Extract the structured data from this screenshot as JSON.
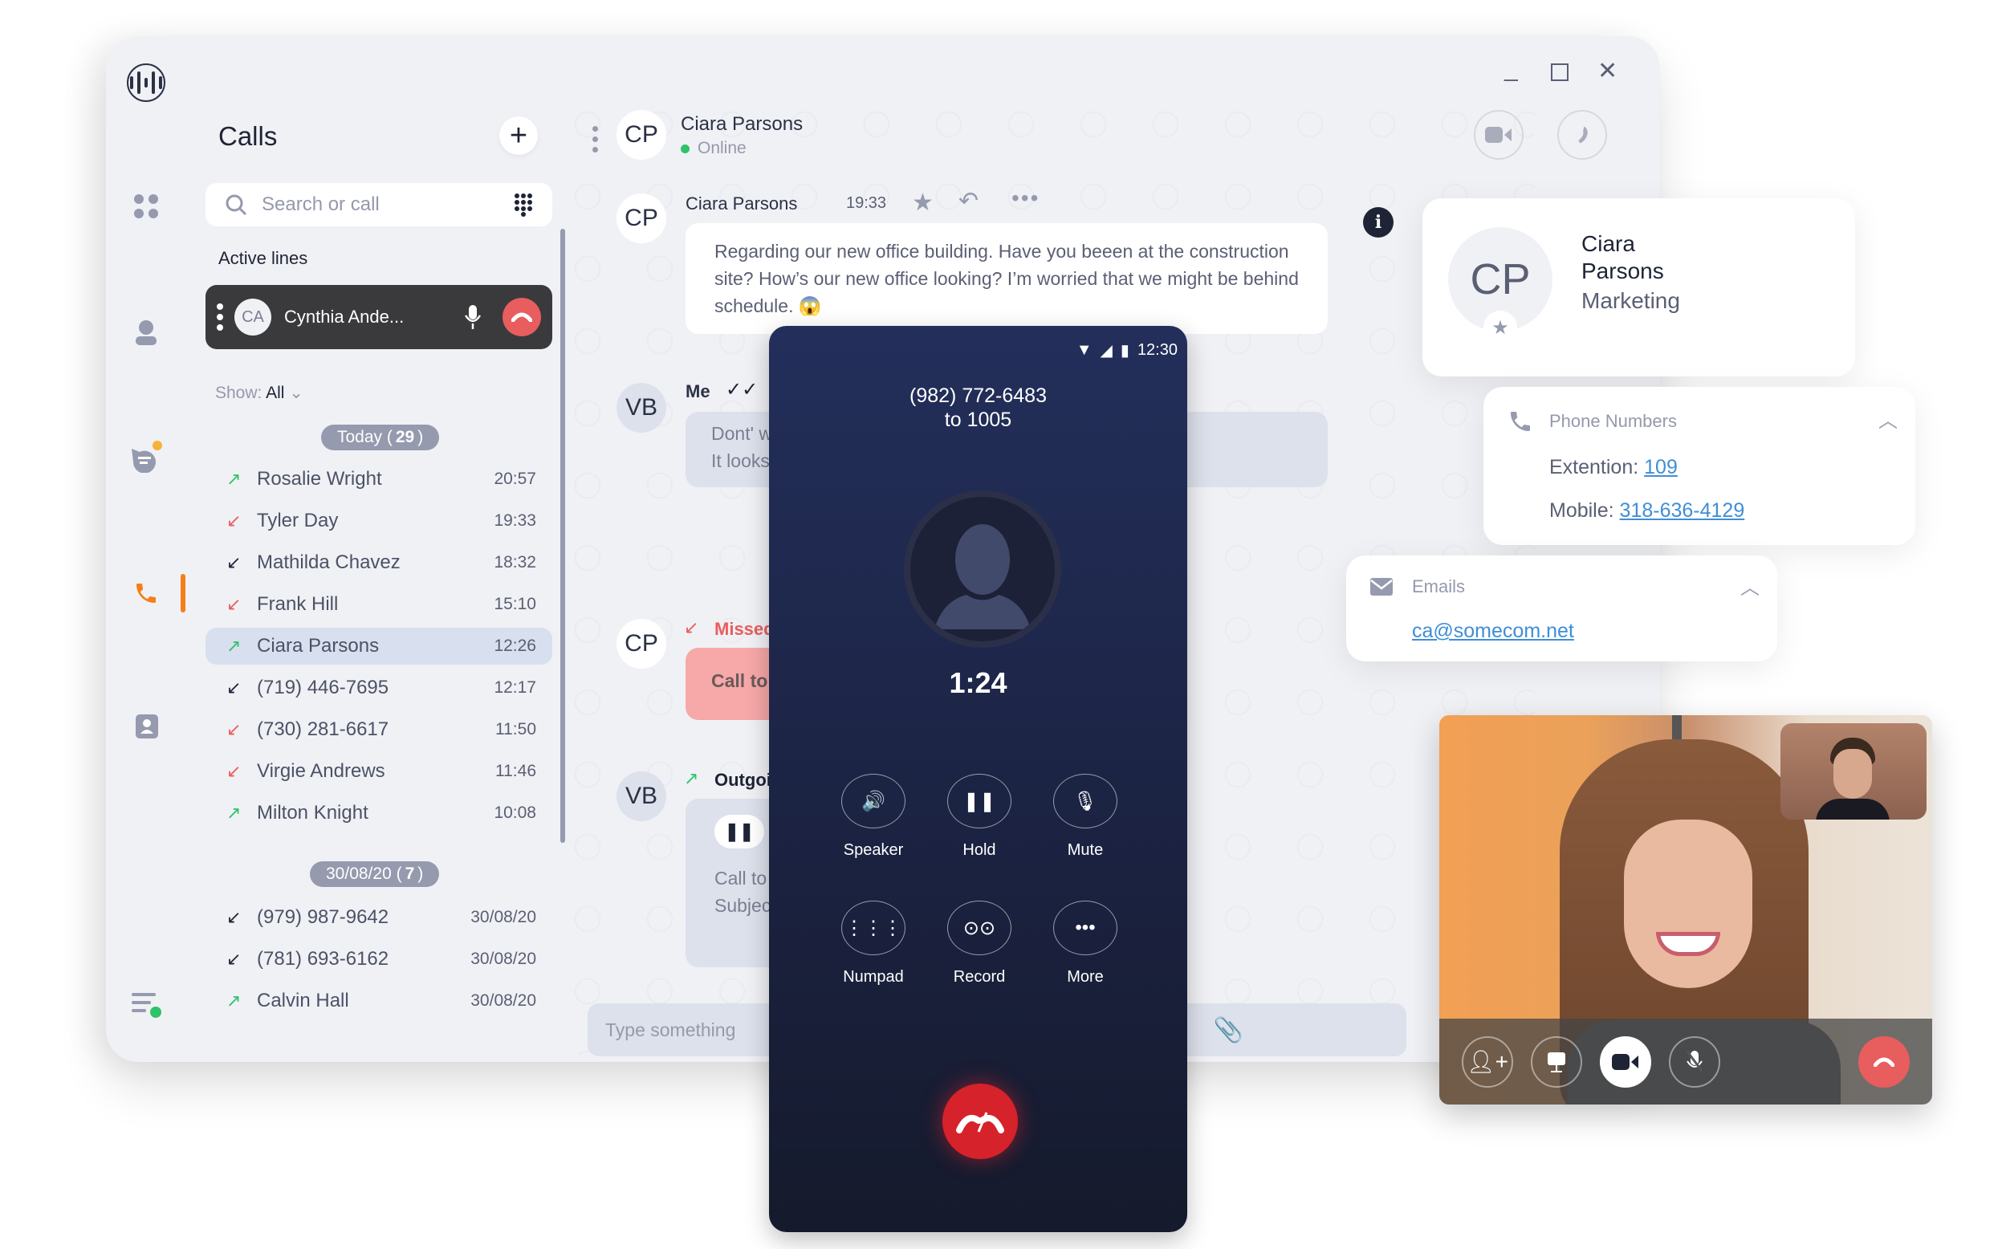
{
  "app": {
    "logo": "app-logo",
    "window_controls": {
      "minimize": "minimize",
      "maximize": "maximize",
      "close": "close"
    },
    "rail": [
      "dashboard-icon",
      "profile-icon",
      "chat-icon",
      "phone-icon",
      "contacts-icon",
      "menu-icon"
    ],
    "calls_panel": {
      "title": "Calls",
      "add_label": "+",
      "search_placeholder": "Search or call",
      "active_lines_label": "Active lines",
      "active_line": {
        "initials": "CA",
        "name": "Cynthia Ande..."
      },
      "show_label": "Show:",
      "show_value": "All",
      "groups": [
        {
          "label": "Today (",
          "count": "29",
          "suffix": ")",
          "calls": [
            {
              "direction": "outgoing",
              "name": "Rosalie Wright",
              "time": "20:57"
            },
            {
              "direction": "missed",
              "name": "Tyler Day",
              "time": "19:33"
            },
            {
              "direction": "incoming",
              "name": "Mathilda Chavez",
              "time": "18:32"
            },
            {
              "direction": "missed",
              "name": "Frank Hill",
              "time": "15:10"
            },
            {
              "direction": "outgoing",
              "name": "Ciara Parsons",
              "time": "12:26",
              "selected": true
            },
            {
              "direction": "incoming",
              "name": "(719) 446-7695",
              "time": "12:17"
            },
            {
              "direction": "missed",
              "name": "(730) 281-6617",
              "time": "11:50"
            },
            {
              "direction": "missed",
              "name": "Virgie Andrews",
              "time": "11:46"
            },
            {
              "direction": "outgoing",
              "name": "Milton Knight",
              "time": "10:08"
            }
          ]
        },
        {
          "label": "30/08/20 (",
          "count": "7",
          "suffix": ")",
          "calls": [
            {
              "direction": "incoming",
              "name": "(979) 987-9642",
              "time": "30/08/20"
            },
            {
              "direction": "incoming",
              "name": "(781) 693-6162",
              "time": "30/08/20"
            },
            {
              "direction": "outgoing",
              "name": "Calvin Hall",
              "time": "30/08/20"
            }
          ]
        }
      ]
    },
    "chat": {
      "contact_initials": "CP",
      "contact_name": "Ciara Parsons",
      "contact_status": "Online",
      "messages": [
        {
          "initials": "CP",
          "author": "Ciara Parsons",
          "time": "19:33",
          "text": "Regarding our new office building. Have you beeen at the construction site? How’s our new office looking? I’m worried that we might be behind schedule.",
          "emoji": "😱"
        },
        {
          "initials": "VB",
          "author": "Me",
          "line1": "Dont' w",
          "line2": "It looks"
        },
        {
          "initials": "CP",
          "label": "Missed",
          "text": "Call to"
        },
        {
          "initials": "VB",
          "label": "Outgoi",
          "line1": "Call to",
          "line2": "Subjec"
        }
      ],
      "input_placeholder": "Type something"
    }
  },
  "phone": {
    "status_time": "12:30",
    "number": "(982) 772-6483",
    "to": "to 1005",
    "timer": "1:24",
    "buttons": [
      {
        "label": "Speaker",
        "icon": "🔊"
      },
      {
        "label": "Hold",
        "icon": "❚❚"
      },
      {
        "label": "Mute",
        "icon": "🎙"
      },
      {
        "label": "Numpad",
        "icon": "⋮⋮⋮"
      },
      {
        "label": "Record",
        "icon": "⊙⊙"
      },
      {
        "label": "More",
        "icon": "•••"
      }
    ]
  },
  "contact_card": {
    "initials": "CP",
    "first": "Ciara",
    "last": "Parsons",
    "department": "Marketing"
  },
  "phone_numbers": {
    "title": "Phone Numbers",
    "ext_label": "Extention:",
    "ext_value": "109",
    "mobile_label": "Mobile:",
    "mobile_value": "318-636-4129"
  },
  "emails": {
    "title": "Emails",
    "email": "ca@somecom.net"
  },
  "video_call": {
    "controls": [
      "add-participant",
      "screen-share",
      "camera",
      "mute",
      "end-call"
    ]
  },
  "colors": {
    "accent": "#f57f17",
    "outgoing": "#2fc26a",
    "missed": "#e85d5d",
    "incoming": "#1e2335",
    "end_call": "#d6222b",
    "link": "#3f8ed6"
  }
}
